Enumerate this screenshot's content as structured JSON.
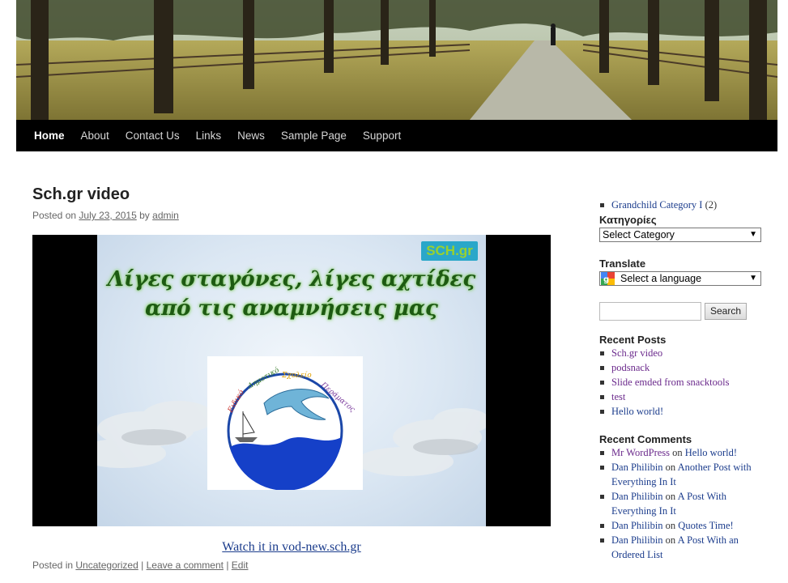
{
  "nav": {
    "items": [
      "Home",
      "About",
      "Contact Us",
      "Links",
      "News",
      "Sample Page",
      "Support"
    ],
    "active": "Home"
  },
  "post": {
    "title": "Sch.gr video",
    "posted_on_label": "Posted on",
    "date": "July 23, 2015",
    "by_label": "by",
    "author": "admin",
    "video": {
      "channel_logo": "SCH.gr",
      "line1": "Λίγες σταγόνες, λίγες αχτίδες",
      "line2": "από τις αναμνήσεις μας",
      "emblem_text": "Ειδικό Δημοτικό Σχολείο Περάματος"
    },
    "watch_link": "Watch it in vod-new.sch.gr",
    "footer": {
      "posted_in_label": "Posted in",
      "category": "Uncategorized",
      "separator": "|",
      "comment_link": "Leave a comment",
      "edit_link": "Edit"
    }
  },
  "sidebar": {
    "category_item": {
      "label": "Grandchild Category I",
      "count": "(2)"
    },
    "categories_heading": "Κατηγορίες",
    "categories_select": "Select Category",
    "translate_heading": "Translate",
    "translate_select": "Select a language",
    "search_button": "Search",
    "recent_posts_heading": "Recent Posts",
    "recent_posts": [
      "Sch.gr video",
      "podsnack",
      "Slide emded from snacktools",
      "test",
      "Hello world!"
    ],
    "recent_comments_heading": "Recent Comments",
    "recent_comments": [
      {
        "author": "Mr WordPress",
        "on": "on",
        "post": "Hello world!"
      },
      {
        "author": "Dan Philibin",
        "on": "on",
        "post": "Another Post with Everything In It"
      },
      {
        "author": "Dan Philibin",
        "on": "on",
        "post": "A Post With Everything In It"
      },
      {
        "author": "Dan Philibin",
        "on": "on",
        "post": "Quotes Time!"
      },
      {
        "author": "Dan Philibin",
        "on": "on",
        "post": "A Post With an Ordered List"
      }
    ]
  },
  "colors": {
    "navbar": "#000000",
    "link": "#1b3c8c",
    "visited_link": "#6b2a8c"
  }
}
